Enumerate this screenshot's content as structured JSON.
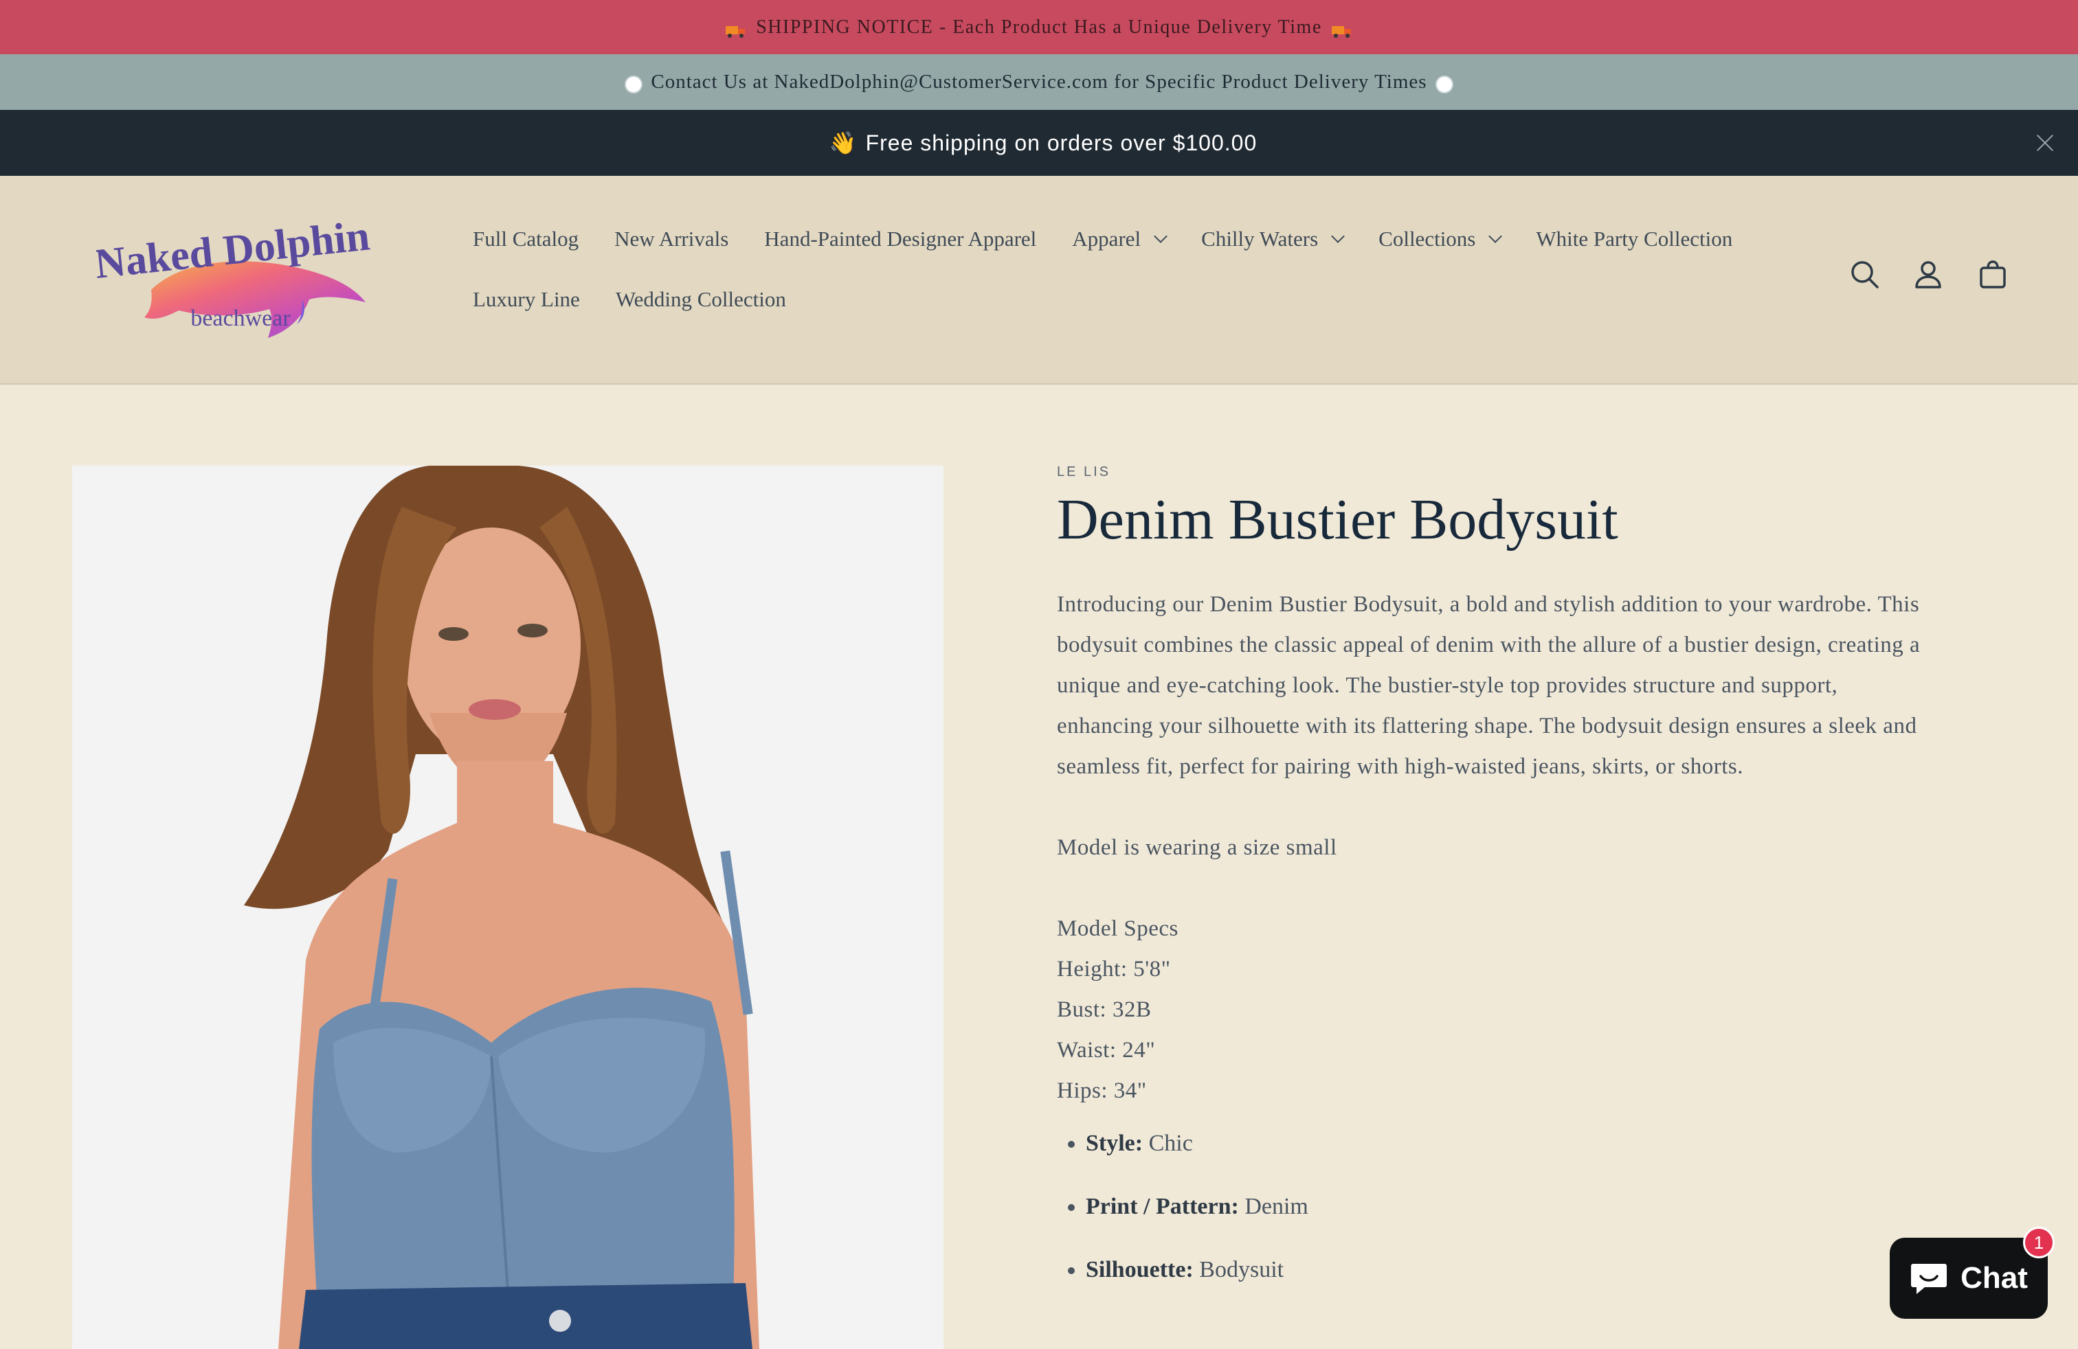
{
  "announcements": {
    "shipping_notice": "SHIPPING NOTICE - Each Product Has a Unique Delivery Time",
    "contact_notice": "Contact Us at NakedDolphin@CustomerService.com for Specific Product Delivery Times",
    "free_shipping_emoji": "👋",
    "free_shipping": "Free shipping on orders over $100.00",
    "colors": {
      "shipping_bar": "#c84a5f",
      "contact_bar": "#95a8a8",
      "promo_bar": "#202a33"
    }
  },
  "logo": {
    "name": "Naked Dolphin",
    "tagline": "beachwear"
  },
  "nav": {
    "row1": [
      {
        "label": "Full Catalog"
      },
      {
        "label": "New Arrivals"
      },
      {
        "label": "Hand-Painted Designer Apparel"
      },
      {
        "label": "Apparel",
        "dropdown": true
      },
      {
        "label": "Chilly Waters",
        "dropdown": true
      },
      {
        "label": "Collections",
        "dropdown": true
      },
      {
        "label": "White Party Collection"
      }
    ],
    "row2": [
      {
        "label": "Luxury Line"
      },
      {
        "label": "Wedding Collection"
      }
    ],
    "icons": [
      "search-icon",
      "account-icon",
      "cart-icon"
    ]
  },
  "product": {
    "vendor": "LE LIS",
    "title": "Denim Bustier Bodysuit",
    "description": "Introducing our Denim Bustier Bodysuit, a bold and stylish addition to your wardrobe. This bodysuit combines the classic appeal of denim with the allure of a bustier design, creating a unique and eye-catching look. The bustier-style top provides structure and support, enhancing your silhouette with its flattering shape. The bodysuit design ensures a sleek and seamless fit, perfect for pairing with high-waisted jeans, skirts, or shorts.",
    "model_note": "Model is wearing a size small",
    "model_specs_heading": "Model Specs",
    "model_specs": [
      "Height: 5'8\"",
      "Bust: 32B",
      "Waist: 24\"",
      "Hips: 34\""
    ],
    "features": [
      {
        "label": "Style:",
        "value": " Chic"
      },
      {
        "label": "Print / Pattern:",
        "value": " Denim"
      },
      {
        "label": "Silhouette:",
        "value": " Bodysuit"
      }
    ]
  },
  "chat": {
    "label": "Chat",
    "badge": "1"
  }
}
